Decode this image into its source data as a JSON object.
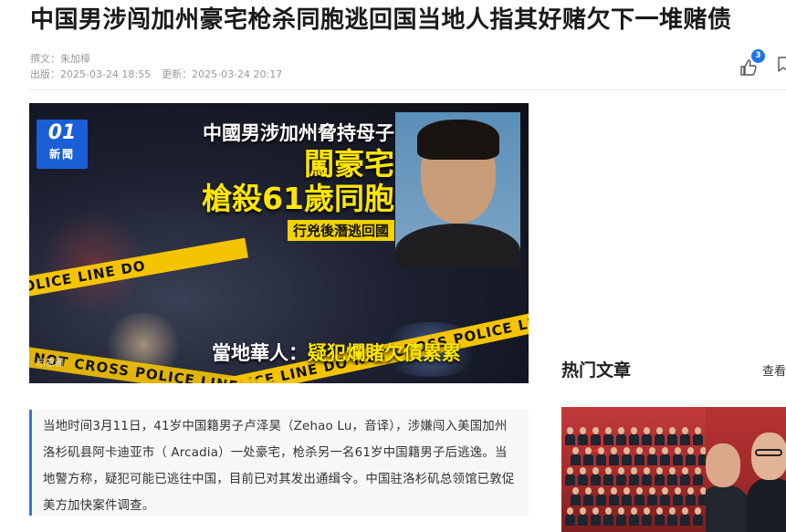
{
  "article": {
    "title": "中国男涉闯加州豪宅枪杀同胞逃回国当地人指其好赌欠下一堆赌债",
    "author": "撰文：朱加樟",
    "published_label": "出版：",
    "published": "2025-03-24 18:55",
    "updated_label": "更新：",
    "updated": "2025-03-24 20:17",
    "like_count": "3",
    "summary": "当地时间3月11日，41岁中国籍男子卢泽昊（Zehao Lu，音译），涉嫌闯入美国加州洛杉矶县阿卡迪亚市（ Arcadia）一处豪宅，枪杀另一名61岁中国籍男子后逃逸。当地警方称，疑犯可能已逃往中国，目前已对其发出通缉令。中国驻洛杉矶总领馆已敦促美方加快案件调查。"
  },
  "hero": {
    "logo_number": "01",
    "logo_text": "新聞",
    "headline_line1": "中國男涉加州脅持母子",
    "headline_line2": "闖豪宅",
    "headline_line3": "槍殺61歲同胞",
    "headline_tag": "行兇後潛逃回國",
    "caption_prefix": "當地華人：",
    "caption_main": "疑犯爛賭欠債累累",
    "sample_label": "示意圖",
    "tape_text_1": "POLICE LINE DO",
    "tape_text_2": "POLICE LINE DO NOT CROSS  POLICE LI",
    "tape_text_3": "DO NOT CROSS  POLICE LINE"
  },
  "sidebar": {
    "hot_title": "热门文章",
    "more_label": "查看"
  },
  "colors": {
    "accent_blue": "#1a73e8",
    "summary_border": "#3b73d4",
    "headline_yellow": "#ffe600",
    "tape_yellow": "#f4c400"
  },
  "icons": {
    "like": "thumbs-up-icon",
    "bookmark": "bookmark-icon"
  }
}
